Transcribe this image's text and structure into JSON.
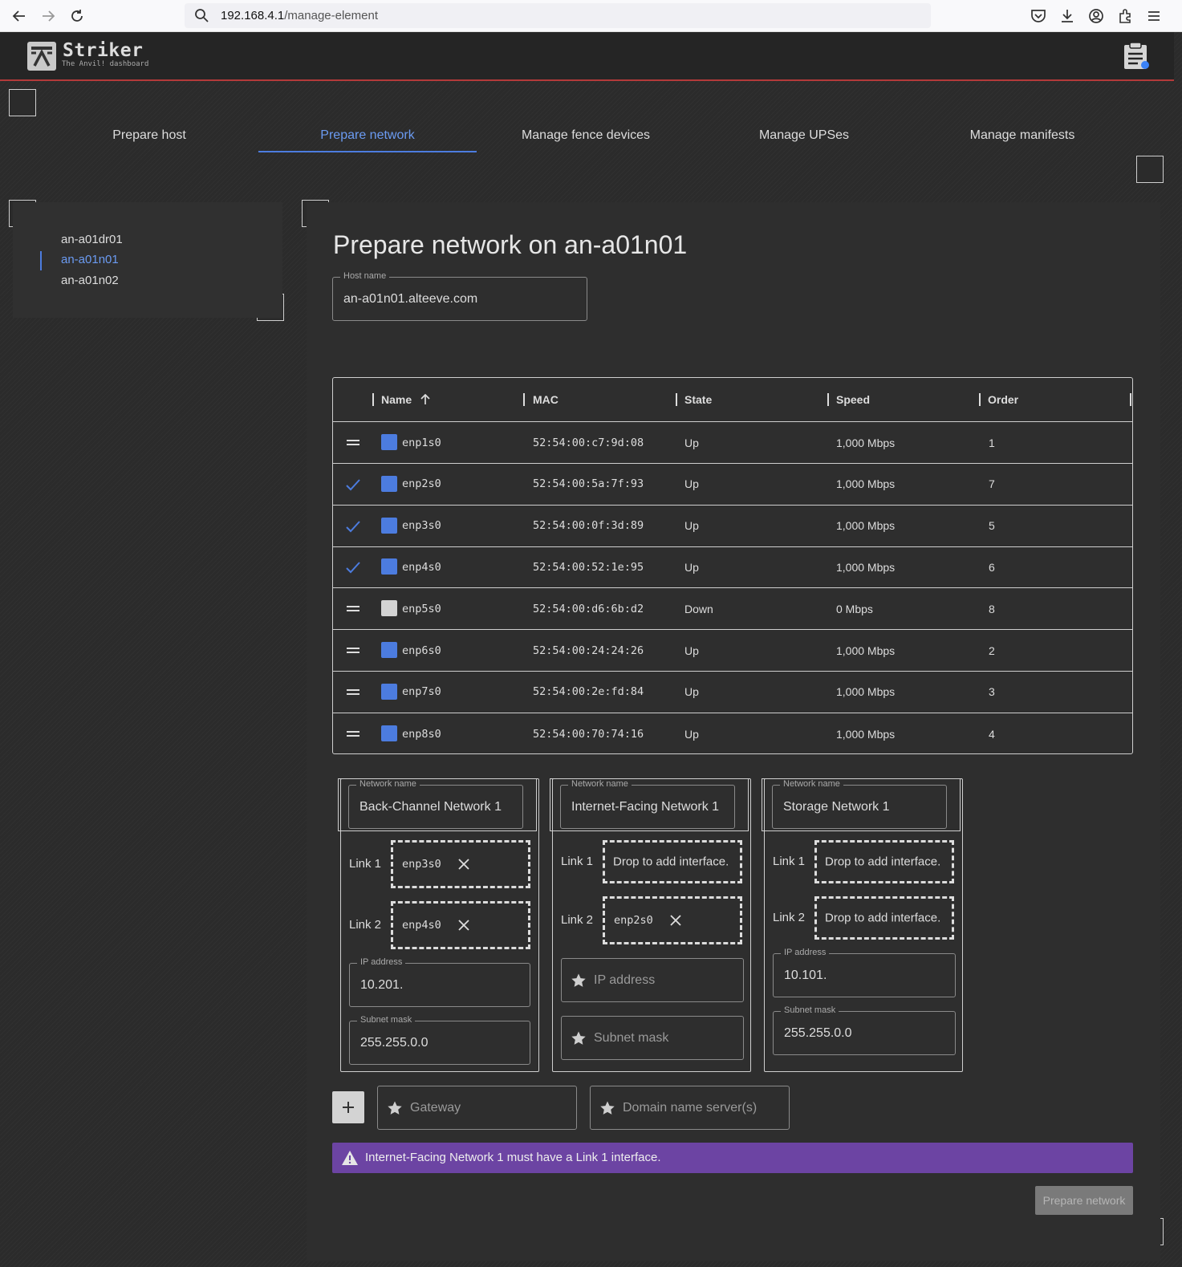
{
  "browser": {
    "url_host": "192.168.4.1",
    "url_path": "/manage-element"
  },
  "app": {
    "title": "Striker",
    "subtitle": "The Anvil! dashboard"
  },
  "tabs": [
    {
      "label": "Prepare host",
      "active": false
    },
    {
      "label": "Prepare network",
      "active": true
    },
    {
      "label": "Manage fence devices",
      "active": false
    },
    {
      "label": "Manage UPSes",
      "active": false
    },
    {
      "label": "Manage manifests",
      "active": false
    }
  ],
  "hosts": [
    {
      "label": "an-a01dr01",
      "active": false
    },
    {
      "label": "an-a01n01",
      "active": true
    },
    {
      "label": "an-a01n02",
      "active": false
    }
  ],
  "main": {
    "title": "Prepare network on an-a01n01",
    "host_name": {
      "label": "Host name",
      "value": "an-a01n01.alteeve.com"
    }
  },
  "table": {
    "columns": [
      "Name",
      "MAC",
      "State",
      "Speed",
      "Order"
    ],
    "rows": [
      {
        "name": "enp1s0",
        "mac": "52:54:00:c7:9d:08",
        "state": "Up",
        "speed": "1,000 Mbps",
        "order": "1",
        "assigned": false
      },
      {
        "name": "enp2s0",
        "mac": "52:54:00:5a:7f:93",
        "state": "Up",
        "speed": "1,000 Mbps",
        "order": "7",
        "assigned": true
      },
      {
        "name": "enp3s0",
        "mac": "52:54:00:0f:3d:89",
        "state": "Up",
        "speed": "1,000 Mbps",
        "order": "5",
        "assigned": true
      },
      {
        "name": "enp4s0",
        "mac": "52:54:00:52:1e:95",
        "state": "Up",
        "speed": "1,000 Mbps",
        "order": "6",
        "assigned": true
      },
      {
        "name": "enp5s0",
        "mac": "52:54:00:d6:6b:d2",
        "state": "Down",
        "speed": "0 Mbps",
        "order": "8",
        "assigned": false
      },
      {
        "name": "enp6s0",
        "mac": "52:54:00:24:24:26",
        "state": "Up",
        "speed": "1,000 Mbps",
        "order": "2",
        "assigned": false
      },
      {
        "name": "enp7s0",
        "mac": "52:54:00:2e:fd:84",
        "state": "Up",
        "speed": "1,000 Mbps",
        "order": "3",
        "assigned": false
      },
      {
        "name": "enp8s0",
        "mac": "52:54:00:70:74:16",
        "state": "Up",
        "speed": "1,000 Mbps",
        "order": "4",
        "assigned": false
      }
    ]
  },
  "networks": [
    {
      "name_label": "Network name",
      "name": "Back-Channel Network 1",
      "link1_label": "Link 1",
      "link1": "enp3s0",
      "link2_label": "Link 2",
      "link2": "enp4s0",
      "ip_label": "IP address",
      "ip": "10.201.",
      "mask_label": "Subnet mask",
      "mask": "255.255.0.0"
    },
    {
      "name_label": "Network name",
      "name": "Internet-Facing Network 1",
      "link1_label": "Link 1",
      "link1_placeholder": "Drop to add interface.",
      "link2_label": "Link 2",
      "link2": "enp2s0",
      "ip_placeholder": "IP address",
      "mask_placeholder": "Subnet mask"
    },
    {
      "name_label": "Network name",
      "name": "Storage Network 1",
      "link1_label": "Link 1",
      "link1_placeholder": "Drop to add interface.",
      "link2_label": "Link 2",
      "link2_placeholder": "Drop to add interface.",
      "ip_label": "IP address",
      "ip": "10.101.",
      "mask_label": "Subnet mask",
      "mask": "255.255.0.0"
    }
  ],
  "gateway_placeholder": "Gateway",
  "dns_placeholder": "Domain name server(s)",
  "alert_message": "Internet-Facing Network 1 must have a Link 1 interface.",
  "submit_label": "Prepare network",
  "colors": {
    "accent": "#4c7cdf",
    "state_up": "#4c7cdf",
    "state_down": "#d3d3d3",
    "alert": "#6c44a3",
    "header_border": "#b33a3a"
  }
}
